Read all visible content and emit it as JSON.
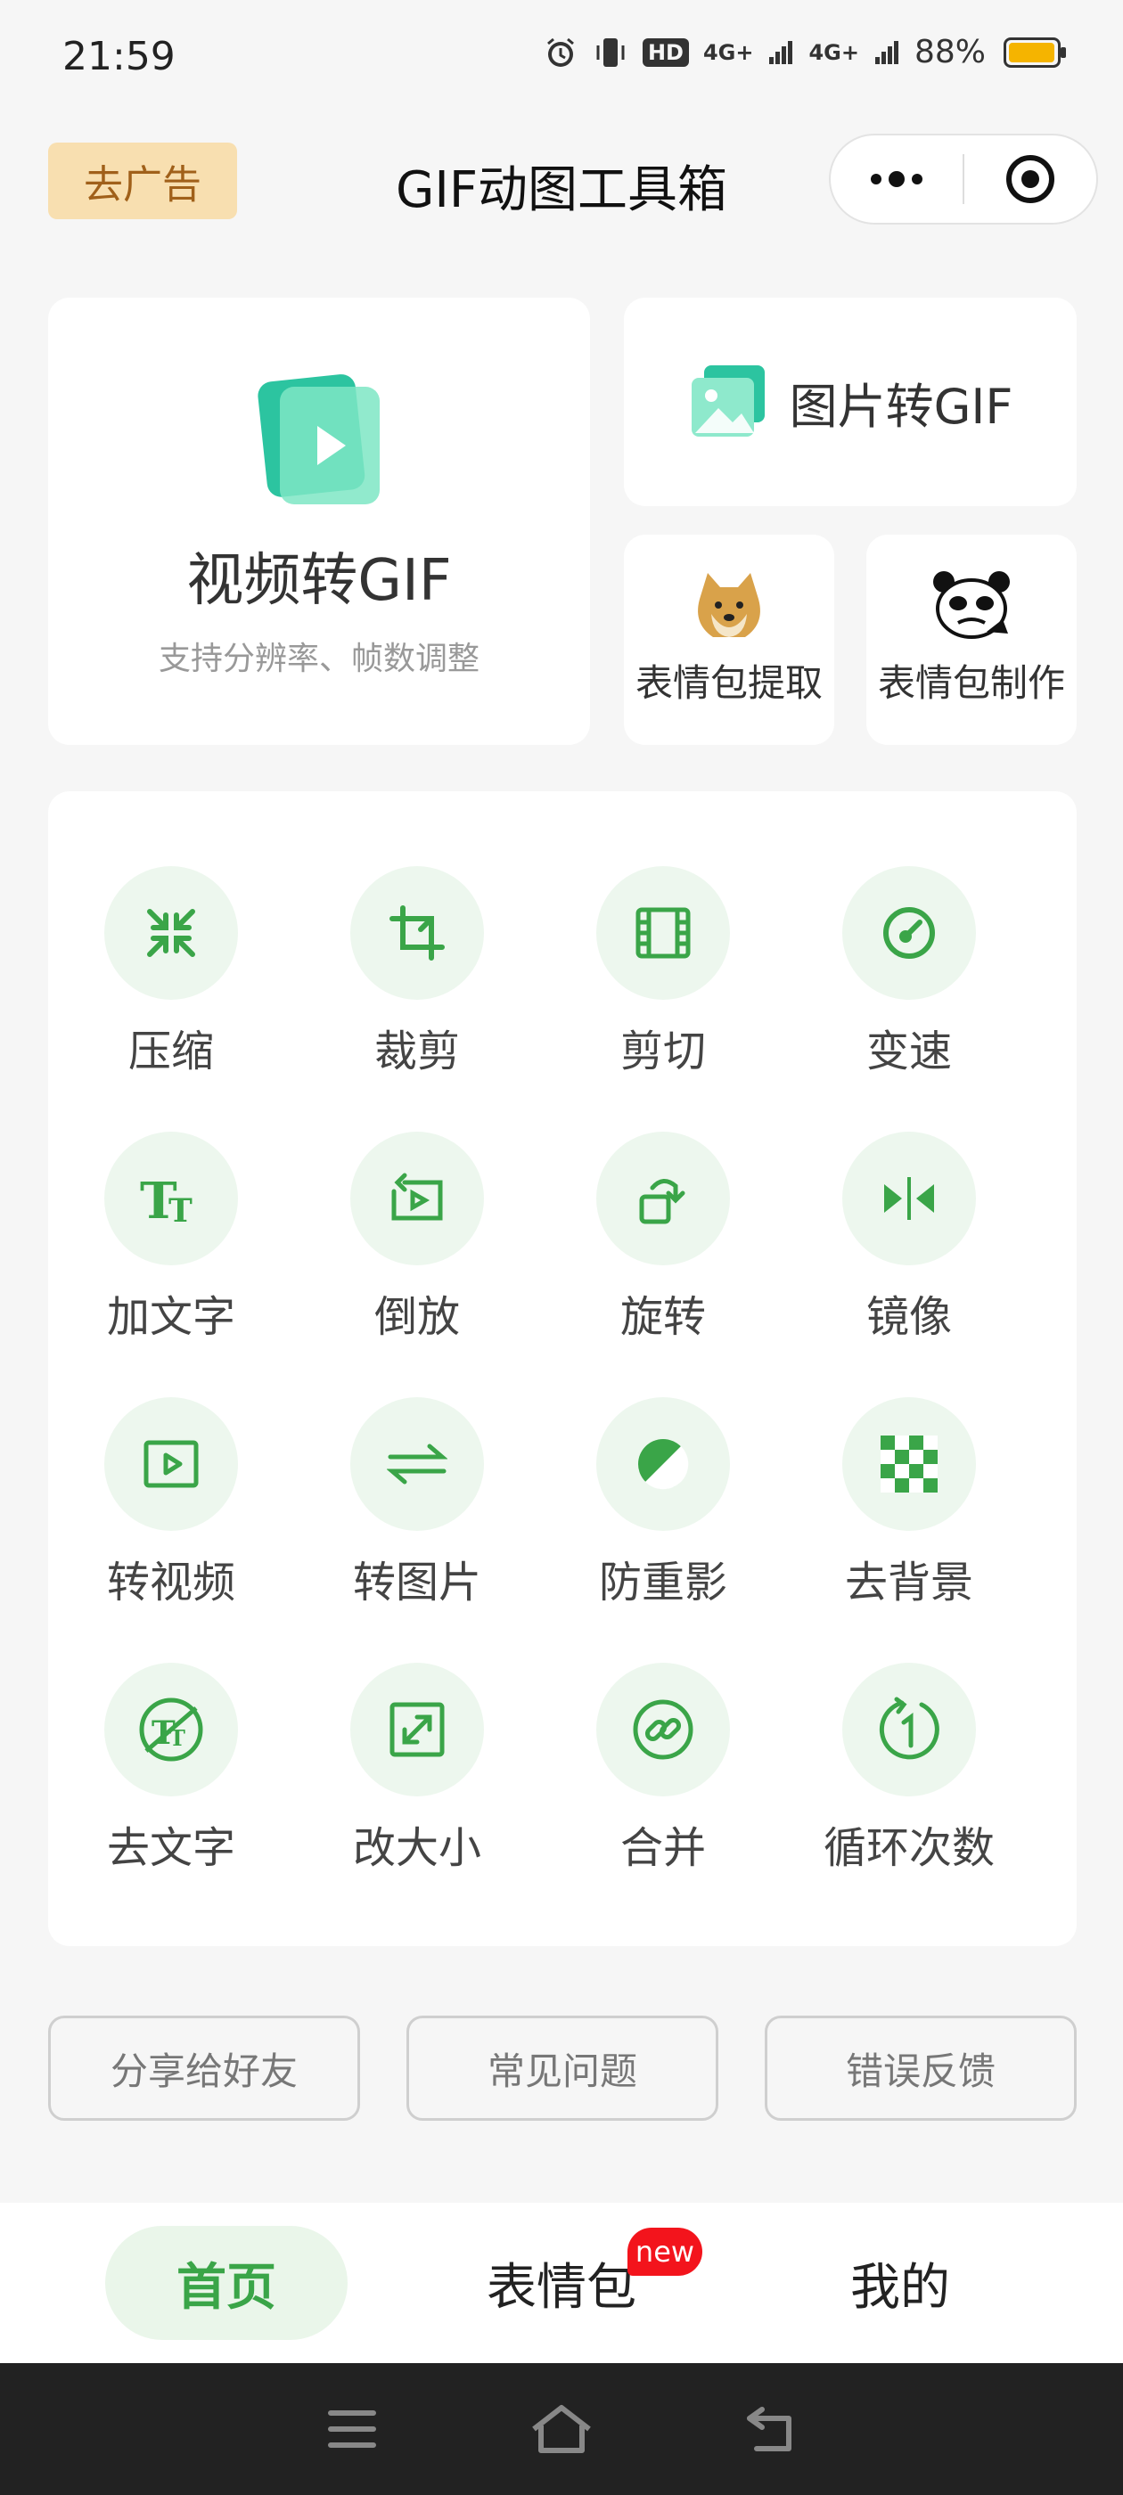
{
  "status_bar": {
    "time": "21:59",
    "hd_label": "HD",
    "net1": "4G+",
    "net2": "4G+",
    "battery_percent": "88%",
    "battery_level": 0.88
  },
  "header": {
    "ad_button": "去广告",
    "title": "GIF动图工具箱"
  },
  "video_card": {
    "title": "视频转GIF",
    "subtitle": "支持分辨率、帧数调整"
  },
  "image_card": {
    "title": "图片转GIF"
  },
  "emoji_extract": {
    "label": "表情包提取"
  },
  "emoji_make": {
    "label": "表情包制作"
  },
  "tools": [
    {
      "label": "压缩",
      "icon": "compress-icon"
    },
    {
      "label": "裁剪",
      "icon": "crop-icon"
    },
    {
      "label": "剪切",
      "icon": "film-icon"
    },
    {
      "label": "变速",
      "icon": "speed-icon"
    },
    {
      "label": "加文字",
      "icon": "text-icon"
    },
    {
      "label": "倒放",
      "icon": "reverse-icon"
    },
    {
      "label": "旋转",
      "icon": "rotate-icon"
    },
    {
      "label": "镜像",
      "icon": "mirror-icon"
    },
    {
      "label": "转视频",
      "icon": "video-icon"
    },
    {
      "label": "转图片",
      "icon": "swap-icon"
    },
    {
      "label": "防重影",
      "icon": "contrast-icon"
    },
    {
      "label": "去背景",
      "icon": "checker-icon"
    },
    {
      "label": "去文字",
      "icon": "remove-text-icon"
    },
    {
      "label": "改大小",
      "icon": "resize-icon"
    },
    {
      "label": "合并",
      "icon": "link-icon"
    },
    {
      "label": "循环次数",
      "icon": "loop-icon"
    }
  ],
  "buttons": {
    "share": "分享给好友",
    "faq": "常见问题",
    "feedback": "错误反馈"
  },
  "tabbar": {
    "home": "首页",
    "emoji": "表情包",
    "mine": "我的",
    "badge": "new"
  },
  "colors": {
    "accent": "#3aa548",
    "tool_bg": "#edf7ee",
    "ad_bg": "#f8dfb0",
    "badge": "#f3141c"
  }
}
